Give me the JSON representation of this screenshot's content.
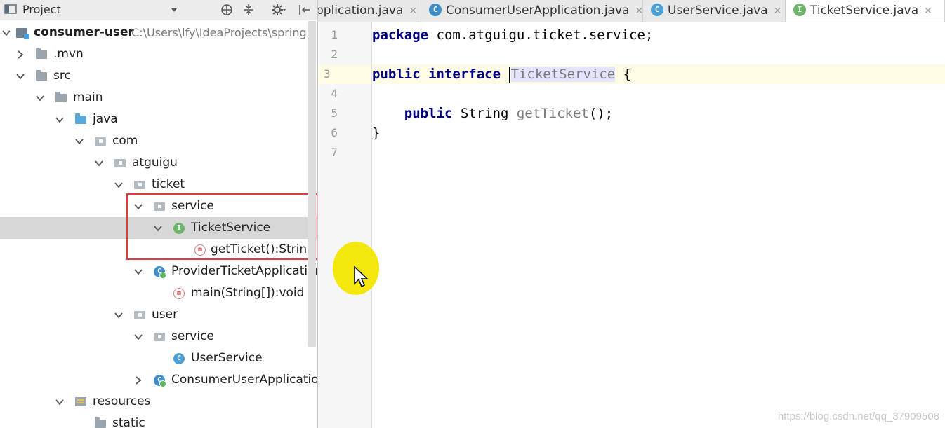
{
  "project_panel": {
    "title": "Project",
    "tree": [
      {
        "name": "tree-item-consumer-user",
        "label": "consumer-user",
        "path": "C:\\Users\\lfy\\IdeaProjects\\springB",
        "icon": "module",
        "arrow": "down"
      },
      {
        "name": "tree-item-mvn",
        "label": ".mvn",
        "icon": "folder",
        "arrow": "right"
      },
      {
        "name": "tree-item-src",
        "label": "src",
        "icon": "folder",
        "arrow": "down"
      },
      {
        "name": "tree-item-main",
        "label": "main",
        "icon": "folder",
        "arrow": "down"
      },
      {
        "name": "tree-item-java",
        "label": "java",
        "icon": "folder-blue",
        "arrow": "down"
      },
      {
        "name": "tree-item-com",
        "label": "com",
        "icon": "package",
        "arrow": "down"
      },
      {
        "name": "tree-item-atguigu",
        "label": "atguigu",
        "icon": "package",
        "arrow": "down"
      },
      {
        "name": "tree-item-ticket",
        "label": "ticket",
        "icon": "package",
        "arrow": "down"
      },
      {
        "name": "tree-item-ticket-service",
        "label": "service",
        "icon": "package",
        "arrow": "down"
      },
      {
        "name": "tree-item-ticketservice-interface",
        "label": "TicketService",
        "icon": "interface",
        "icon_letter": "I",
        "arrow": "down",
        "selected": true
      },
      {
        "name": "tree-item-getticket-method",
        "label": "getTicket():String",
        "icon": "method",
        "icon_letter": "m",
        "arrow": ""
      },
      {
        "name": "tree-item-providerticketapplication",
        "label": "ProviderTicketApplication",
        "icon": "spring-class",
        "icon_letter": "C",
        "arrow": "down"
      },
      {
        "name": "tree-item-main-method",
        "label": "main(String[]):void",
        "icon": "method",
        "icon_letter": "m",
        "arrow": ""
      },
      {
        "name": "tree-item-user",
        "label": "user",
        "icon": "package",
        "arrow": "down"
      },
      {
        "name": "tree-item-user-service",
        "label": "service",
        "icon": "package",
        "arrow": "down"
      },
      {
        "name": "tree-item-userservice-class",
        "label": "UserService",
        "icon": "class",
        "icon_letter": "C",
        "arrow": ""
      },
      {
        "name": "tree-item-consumeruserapplication",
        "label": "ConsumerUserApplication",
        "icon": "spring-class",
        "icon_letter": "C",
        "arrow": "right"
      },
      {
        "name": "tree-item-resources",
        "label": "resources",
        "icon": "resources-folder",
        "arrow": "down"
      },
      {
        "name": "tree-item-static",
        "label": "static",
        "icon": "folder",
        "arrow": ""
      }
    ]
  },
  "editor": {
    "tabs": [
      {
        "label": "pplication.java",
        "icon": "",
        "active": false
      },
      {
        "label": "ConsumerUserApplication.java",
        "icon": "spring-class",
        "icon_letter": "C",
        "active": false
      },
      {
        "label": "UserService.java",
        "icon": "class",
        "icon_letter": "C",
        "active": false
      },
      {
        "label": "TicketService.java",
        "icon": "interface",
        "icon_letter": "I",
        "active": true
      }
    ],
    "line_numbers": [
      "1",
      "2",
      "3",
      "4",
      "5",
      "6",
      "7"
    ],
    "current_line": 3,
    "code": {
      "line1_kw": "package",
      "line1_rest": " com.atguigu.ticket.service;",
      "line3_kw1": "public",
      "line3_kw2": "interface",
      "line3_ident": "TicketService",
      "line3_rest": " {",
      "line5_kw": "public",
      "line5_type": " String ",
      "line5_method": "getTicket",
      "line5_rest": "();",
      "line6": "}"
    }
  },
  "watermark": "https://blog.csdn.net/qq_37909508",
  "colors": {
    "keyword": "#000080",
    "highlight_box": "#e23b3b",
    "cursor_halo": "#f2e600",
    "selected_row": "#d7d7d7",
    "current_line": "#fdfbe4"
  }
}
